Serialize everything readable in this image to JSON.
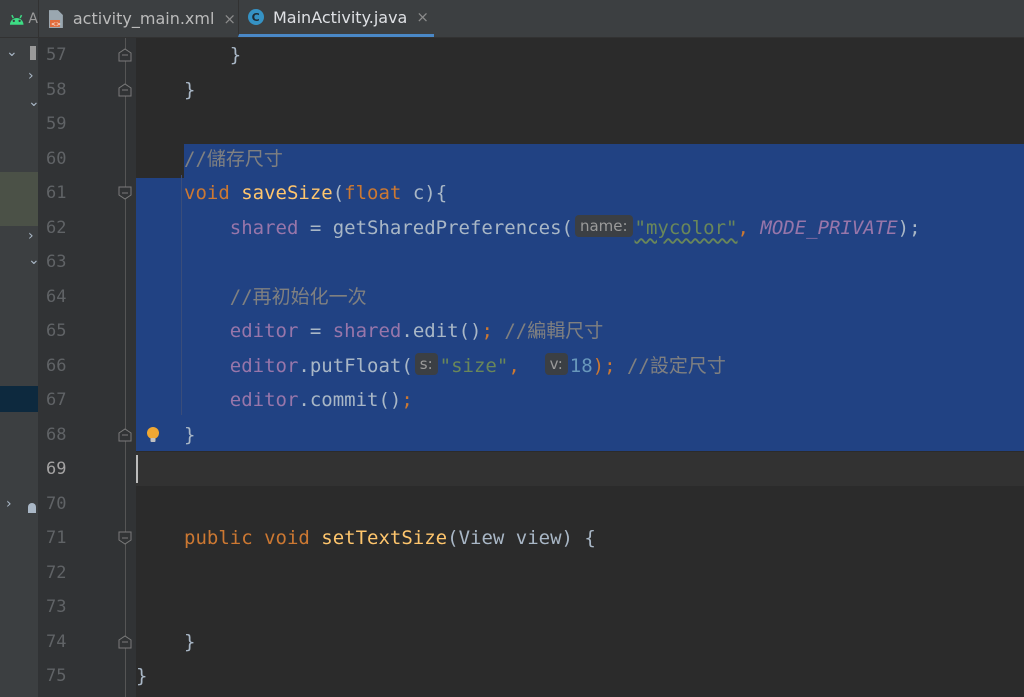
{
  "tabs": [
    {
      "name": "activity_main.xml",
      "icon": "xml-file-icon",
      "active": false,
      "close": "×"
    },
    {
      "name": "MainActivity.java",
      "icon": "java-class-icon",
      "active": true,
      "close": "×"
    }
  ],
  "leftstrip": {
    "partial_label": "A"
  },
  "editor": {
    "current_line": 69,
    "lines": [
      {
        "n": "57",
        "tokens": [
          {
            "t": "    }",
            "c": "plain"
          }
        ]
      },
      {
        "n": "58",
        "tokens": [
          {
            "t": "}",
            "c": "plain"
          }
        ]
      },
      {
        "n": "59",
        "tokens": []
      },
      {
        "n": "60",
        "tokens": [
          {
            "t": "//儲存尺寸",
            "c": "cm"
          }
        ]
      },
      {
        "n": "61",
        "tokens": [
          {
            "t": "void ",
            "c": "kw"
          },
          {
            "t": "saveSize",
            "c": "fn"
          },
          {
            "t": "(",
            "c": "plain"
          },
          {
            "t": "float ",
            "c": "kw"
          },
          {
            "t": "c){",
            "c": "plain"
          }
        ]
      },
      {
        "n": "62",
        "tokens": [
          {
            "t": "    ",
            "c": "plain"
          },
          {
            "t": "shared",
            "c": "fld"
          },
          {
            "t": " = getSharedPreferences(",
            "c": "plain"
          },
          {
            "t": "name:",
            "c": "hint"
          },
          {
            "t": "\"mycolor\"",
            "c": "str"
          },
          {
            "t": ", ",
            "c": "kw"
          },
          {
            "t": "MODE_PRIVATE",
            "c": "cst"
          },
          {
            "t": ");",
            "c": "plain"
          }
        ]
      },
      {
        "n": "63",
        "tokens": []
      },
      {
        "n": "64",
        "tokens": [
          {
            "t": "    ",
            "c": "plain"
          },
          {
            "t": "//再初始化一次",
            "c": "cm"
          }
        ]
      },
      {
        "n": "65",
        "tokens": [
          {
            "t": "    ",
            "c": "plain"
          },
          {
            "t": "editor",
            "c": "fld"
          },
          {
            "t": " = ",
            "c": "plain"
          },
          {
            "t": "shared",
            "c": "fld"
          },
          {
            "t": ".edit()",
            "c": "plain"
          },
          {
            "t": "; ",
            "c": "kw"
          },
          {
            "t": "//編輯尺寸",
            "c": "cm"
          }
        ]
      },
      {
        "n": "66",
        "tokens": [
          {
            "t": "    ",
            "c": "plain"
          },
          {
            "t": "editor",
            "c": "fld"
          },
          {
            "t": ".putFloat(",
            "c": "plain"
          },
          {
            "t": "s:",
            "c": "hint"
          },
          {
            "t": "\"size\"",
            "c": "str"
          },
          {
            "t": ",  ",
            "c": "kw"
          },
          {
            "t": "v:",
            "c": "hint"
          },
          {
            "t": "18",
            "c": "num"
          },
          {
            "t": "); ",
            "c": "kw"
          },
          {
            "t": "//設定尺寸",
            "c": "cm"
          }
        ]
      },
      {
        "n": "67",
        "tokens": [
          {
            "t": "    ",
            "c": "plain"
          },
          {
            "t": "editor",
            "c": "fld"
          },
          {
            "t": ".commit()",
            "c": "plain"
          },
          {
            "t": ";",
            "c": "kw"
          }
        ]
      },
      {
        "n": "68",
        "tokens": [
          {
            "t": "}",
            "c": "plain"
          }
        ]
      },
      {
        "n": "69",
        "tokens": []
      },
      {
        "n": "70",
        "tokens": []
      },
      {
        "n": "71",
        "tokens": [
          {
            "t": "public void ",
            "c": "kw"
          },
          {
            "t": "setTextSize",
            "c": "fn"
          },
          {
            "t": "(View view) {",
            "c": "plain"
          }
        ]
      },
      {
        "n": "72",
        "tokens": []
      },
      {
        "n": "73",
        "tokens": []
      },
      {
        "n": "74",
        "tokens": [
          {
            "t": "}",
            "c": "plain"
          }
        ]
      },
      {
        "n": "75",
        "tokens": [
          {
            "t": "}",
            "c": "plain"
          }
        ]
      }
    ]
  },
  "colors": {
    "selection": "#214283",
    "background": "#2b2b2b",
    "gutter": "#313335"
  }
}
